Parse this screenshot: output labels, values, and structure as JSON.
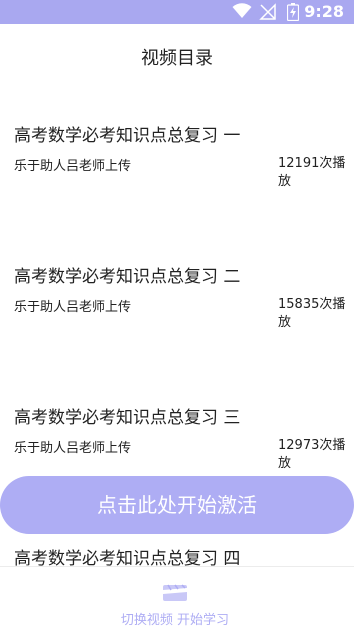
{
  "status_bar": {
    "time": "9:28",
    "background_color": "#a9a8f0",
    "icons": [
      "wifi-icon",
      "no-signal-icon",
      "battery-charging-icon"
    ]
  },
  "header": {
    "title": "视频目录"
  },
  "videos": [
    {
      "title": "高考数学必考知识点总复习 一",
      "uploader": "乐于助人吕老师上传",
      "plays": "12191次播放"
    },
    {
      "title": "高考数学必考知识点总复习 二",
      "uploader": "乐于助人吕老师上传",
      "plays": "15835次播放"
    },
    {
      "title": "高考数学必考知识点总复习 三",
      "uploader": "乐于助人吕老师上传",
      "plays": "12973次播放"
    },
    {
      "title": "高考数学必考知识点总复习 四"
    }
  ],
  "activate_button": {
    "label": "点击此处开始激活",
    "color": "#aeadf4"
  },
  "bottom_bar": {
    "tab_label": "切换视频 开始学习",
    "tab_icon": "video-clip-icon",
    "accent_color": "#aeadf4"
  }
}
